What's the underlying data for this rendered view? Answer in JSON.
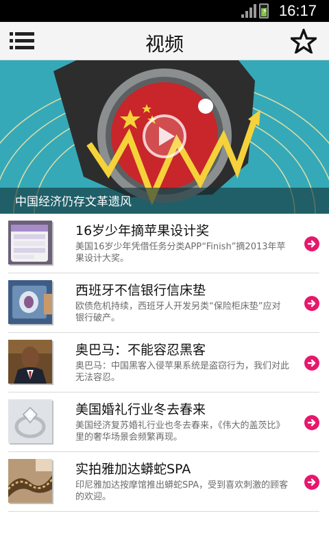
{
  "status_bar": {
    "time": "16:17",
    "signal_icon": "signal-bars-icon",
    "battery_icon": "battery-charging-icon"
  },
  "app_bar": {
    "title": "视频",
    "menu_icon": "list-menu-icon",
    "favorite_icon": "star-outline-icon"
  },
  "featured": {
    "caption": "中国经济仍存文革遗风",
    "play_icon": "play-icon"
  },
  "videos": [
    {
      "headline": "16岁少年摘苹果设计奖",
      "summary": "美国16岁少年凭借任务分类APP“Finish”摘2013年苹果设计大奖。"
    },
    {
      "headline": "西班牙不信银行信床垫",
      "summary": "欧债危机持续，西班牙人开发另类“保险柜床垫”应对银行破产。"
    },
    {
      "headline": "奥巴马：不能容忍黑客",
      "summary": "奥巴马：中国黑客入侵苹果系统是盗窃行为，我们对此无法容忍。"
    },
    {
      "headline": "美国婚礼行业冬去春来",
      "summary": "美国经济复苏婚礼行业也冬去春来，《伟大的盖茨比》里的奢华场景会频繁再现。"
    },
    {
      "headline": "实拍雅加达蟒蛇SPA",
      "summary": "印尼雅加达按摩馆推出蟒蛇SPA，受到喜欢刺激的顾客的欢迎。"
    }
  ],
  "colors": {
    "accent": "#e6176c",
    "hero_background": "#35a9b8"
  }
}
